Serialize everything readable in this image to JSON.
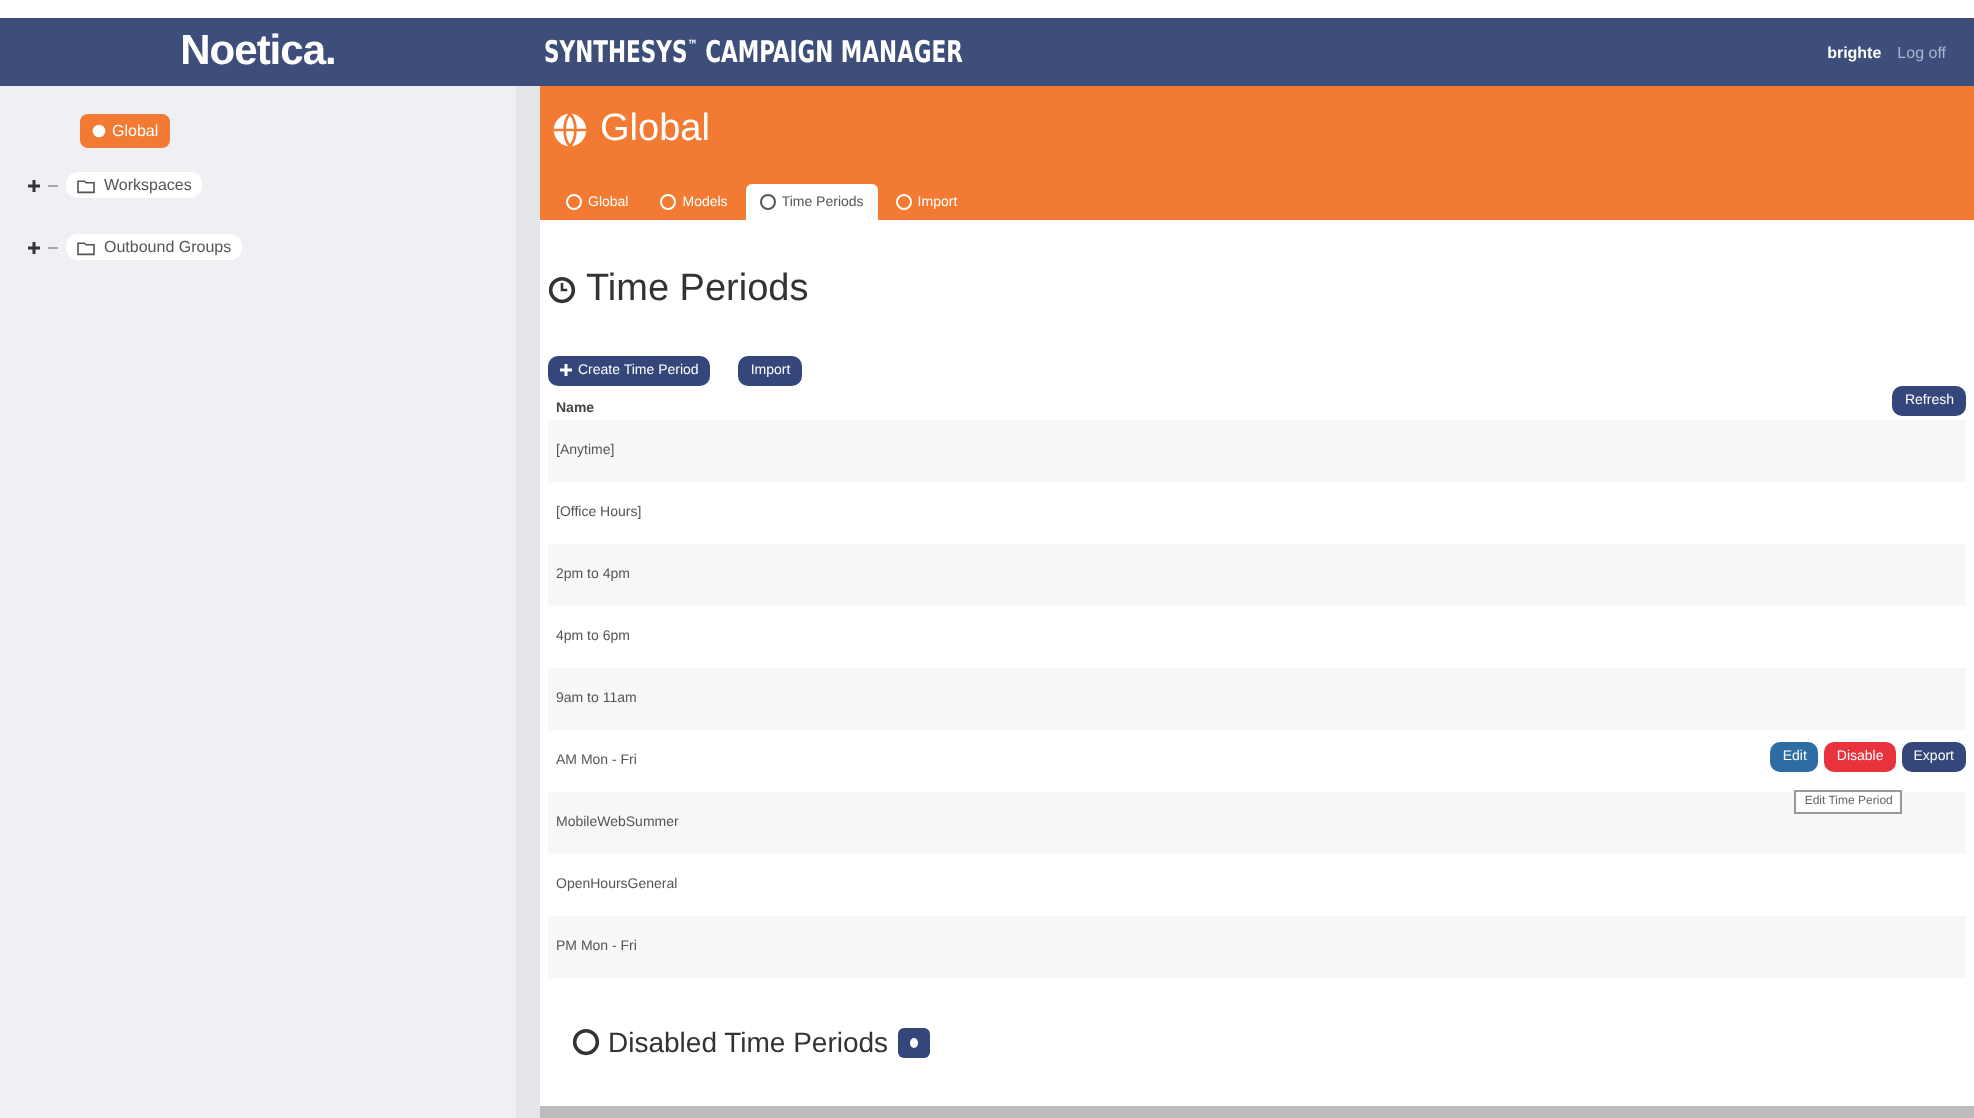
{
  "header": {
    "logo": "Noetica.",
    "title": "SYNTHESYS",
    "title_mark": "™",
    "title_rest": "CAMPAIGN MANAGER",
    "user": "brighte",
    "logoff": "Log off"
  },
  "sidebar": {
    "root": "Global",
    "items": [
      {
        "label": "Workspaces",
        "expanded": false
      },
      {
        "label": "Outbound Groups",
        "expanded": false
      }
    ]
  },
  "banner": {
    "title": "Global",
    "tabs": [
      {
        "label": "Global",
        "selected": false
      },
      {
        "label": "Models",
        "selected": false
      },
      {
        "label": "Time Periods",
        "selected": true
      },
      {
        "label": "Import",
        "selected": false
      }
    ]
  },
  "section": {
    "title": "Time Periods",
    "actions": [
      "Create Time Period",
      "Import"
    ],
    "refresh": "Refresh"
  },
  "table": {
    "columns": [
      "Name"
    ],
    "rows": [
      {
        "name": "[Anytime]",
        "hover": false
      },
      {
        "name": "[Office Hours]",
        "hover": false
      },
      {
        "name": "2pm to 4pm",
        "hover": false
      },
      {
        "name": "4pm to 6pm",
        "hover": false
      },
      {
        "name": "9am to 11am",
        "hover": false
      },
      {
        "name": "AM Mon - Fri",
        "hover": true
      },
      {
        "name": "MobileWebSummer",
        "hover": false
      },
      {
        "name": "OpenHoursGeneral",
        "hover": false
      },
      {
        "name": "PM Mon - Fri",
        "hover": false
      }
    ],
    "row_actions": [
      {
        "label": "Edit",
        "kind": "edit"
      },
      {
        "label": "Disable",
        "kind": "disable"
      },
      {
        "label": "Export",
        "kind": "export"
      }
    ],
    "tooltip": "Edit Time Period"
  },
  "disabled": {
    "title": "Disabled Time Periods",
    "expanded": false
  }
}
